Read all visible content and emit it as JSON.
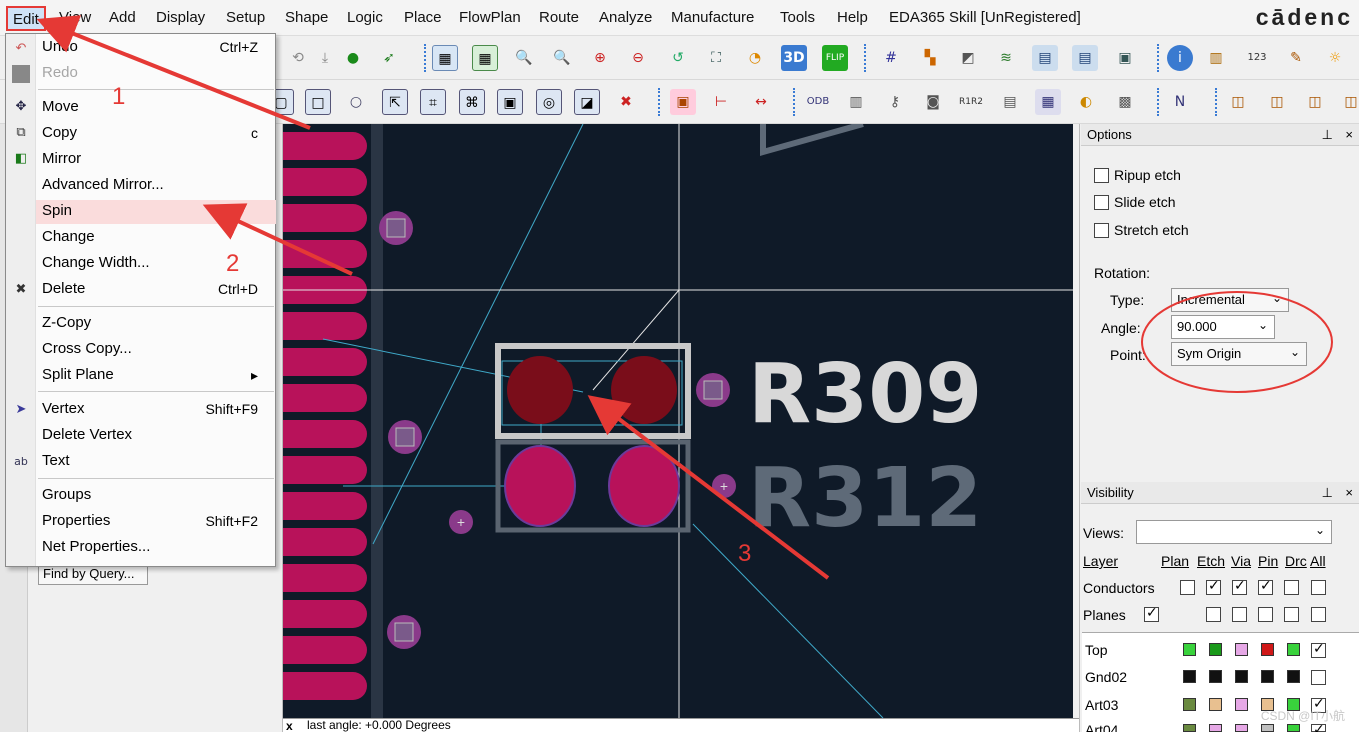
{
  "menubar": {
    "items": [
      "Edit",
      "View",
      "Add",
      "Display",
      "Setup",
      "Shape",
      "Logic",
      "Place",
      "FlowPlan",
      "Route",
      "Analyze",
      "Manufacture",
      "Tools",
      "Help",
      "EDA365 Skill [UnRegistered]"
    ],
    "brand": "cādenc"
  },
  "edit_menu": {
    "items": [
      {
        "label": "Undo",
        "shortcut": "Ctrl+Z",
        "icon": "undo-icon"
      },
      {
        "label": "Redo",
        "shortcut": "",
        "icon": "redo-icon",
        "disabled": true
      },
      {
        "label": "Move",
        "shortcut": "",
        "icon": "move-icon"
      },
      {
        "label": "Copy",
        "shortcut": "c",
        "icon": "copy-icon"
      },
      {
        "label": "Mirror",
        "shortcut": "",
        "icon": "mirror-icon"
      },
      {
        "label": "Advanced Mirror...",
        "shortcut": ""
      },
      {
        "label": "Spin",
        "shortcut": "",
        "highlighted": true
      },
      {
        "label": "Change",
        "shortcut": ""
      },
      {
        "label": "Change Width...",
        "shortcut": ""
      },
      {
        "label": "Delete",
        "shortcut": "Ctrl+D",
        "icon": "delete-icon"
      },
      {
        "label": "Z-Copy",
        "shortcut": ""
      },
      {
        "label": "Cross Copy...",
        "shortcut": ""
      },
      {
        "label": "Split Plane",
        "shortcut": "▸"
      },
      {
        "label": "Vertex",
        "shortcut": "Shift+F9",
        "icon": "vertex-icon"
      },
      {
        "label": "Delete Vertex",
        "shortcut": ""
      },
      {
        "label": "Text",
        "shortcut": "",
        "icon": "text-icon"
      },
      {
        "label": "Groups",
        "shortcut": ""
      },
      {
        "label": "Properties",
        "shortcut": "Shift+F2"
      },
      {
        "label": "Net Properties...",
        "shortcut": ""
      }
    ]
  },
  "left_panel": {
    "find_by_query": "Find by Query..."
  },
  "canvas": {
    "labels": [
      "R309",
      "R312"
    ]
  },
  "statusbar": {
    "close": "x",
    "text": "last angle: +0.000 Degrees"
  },
  "options_panel": {
    "title": "Options",
    "ripup_etch": "Ripup etch",
    "slide_etch": "Slide etch",
    "stretch_etch": "Stretch etch",
    "rotation_label": "Rotation:",
    "type_label": "Type:",
    "type_value": "Incremental",
    "angle_label": "Angle:",
    "angle_value": "90.000",
    "point_label": "Point:",
    "point_value": "Sym Origin"
  },
  "visibility_panel": {
    "title": "Visibility",
    "views_label": "Views:",
    "columns": [
      "Layer",
      "Plan",
      "Etch",
      "Via",
      "Pin",
      "Drc",
      "All"
    ],
    "rows": [
      {
        "name": "Conductors",
        "checks": [
          false,
          true,
          true,
          true,
          false,
          false
        ]
      },
      {
        "name": "Planes",
        "checks": [
          true,
          false,
          false,
          false,
          false,
          false
        ]
      },
      {
        "name": "Top",
        "colors": [
          "#39d23c",
          "#1a9a1a",
          "#e6a8e6",
          "#d01818",
          "#39d23c"
        ],
        "all": true
      },
      {
        "name": "Gnd02",
        "colors": [
          "#111111",
          "#111111",
          "#111111",
          "#111111",
          "#111111"
        ],
        "all": false
      },
      {
        "name": "Art03",
        "colors": [
          "#6a8a40",
          "#e8c090",
          "#e6a8e6",
          "#e8c090",
          "#39d23c"
        ],
        "all": true
      },
      {
        "name": "Art04",
        "colors": [
          "#6a8a40",
          "#e6a8e6",
          "#e6a8e6",
          "#c0c0c0",
          "#39d23c"
        ],
        "all": true
      }
    ]
  },
  "annotations": [
    "1",
    "2",
    "3"
  ],
  "watermark": "CSDN @IT小航"
}
